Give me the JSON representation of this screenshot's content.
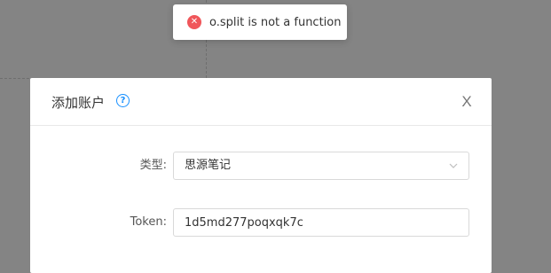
{
  "toast": {
    "icon": "close-circle-icon",
    "message": "o.split is not a function",
    "status_color": "#f0565a"
  },
  "modal": {
    "title": "添加账户",
    "help_icon": "question-circle-icon",
    "help_glyph": "?",
    "close_glyph": "X",
    "close_icon": "close-icon"
  },
  "form": {
    "type": {
      "label": "类型:",
      "value": "思源笔记",
      "icon": "chevron-down-icon"
    },
    "token": {
      "label": "Token:",
      "value": "1d5md277poqxqk7c"
    }
  },
  "colors": {
    "accent": "#1890ff",
    "overlay": "#848484",
    "error": "#f0565a"
  }
}
